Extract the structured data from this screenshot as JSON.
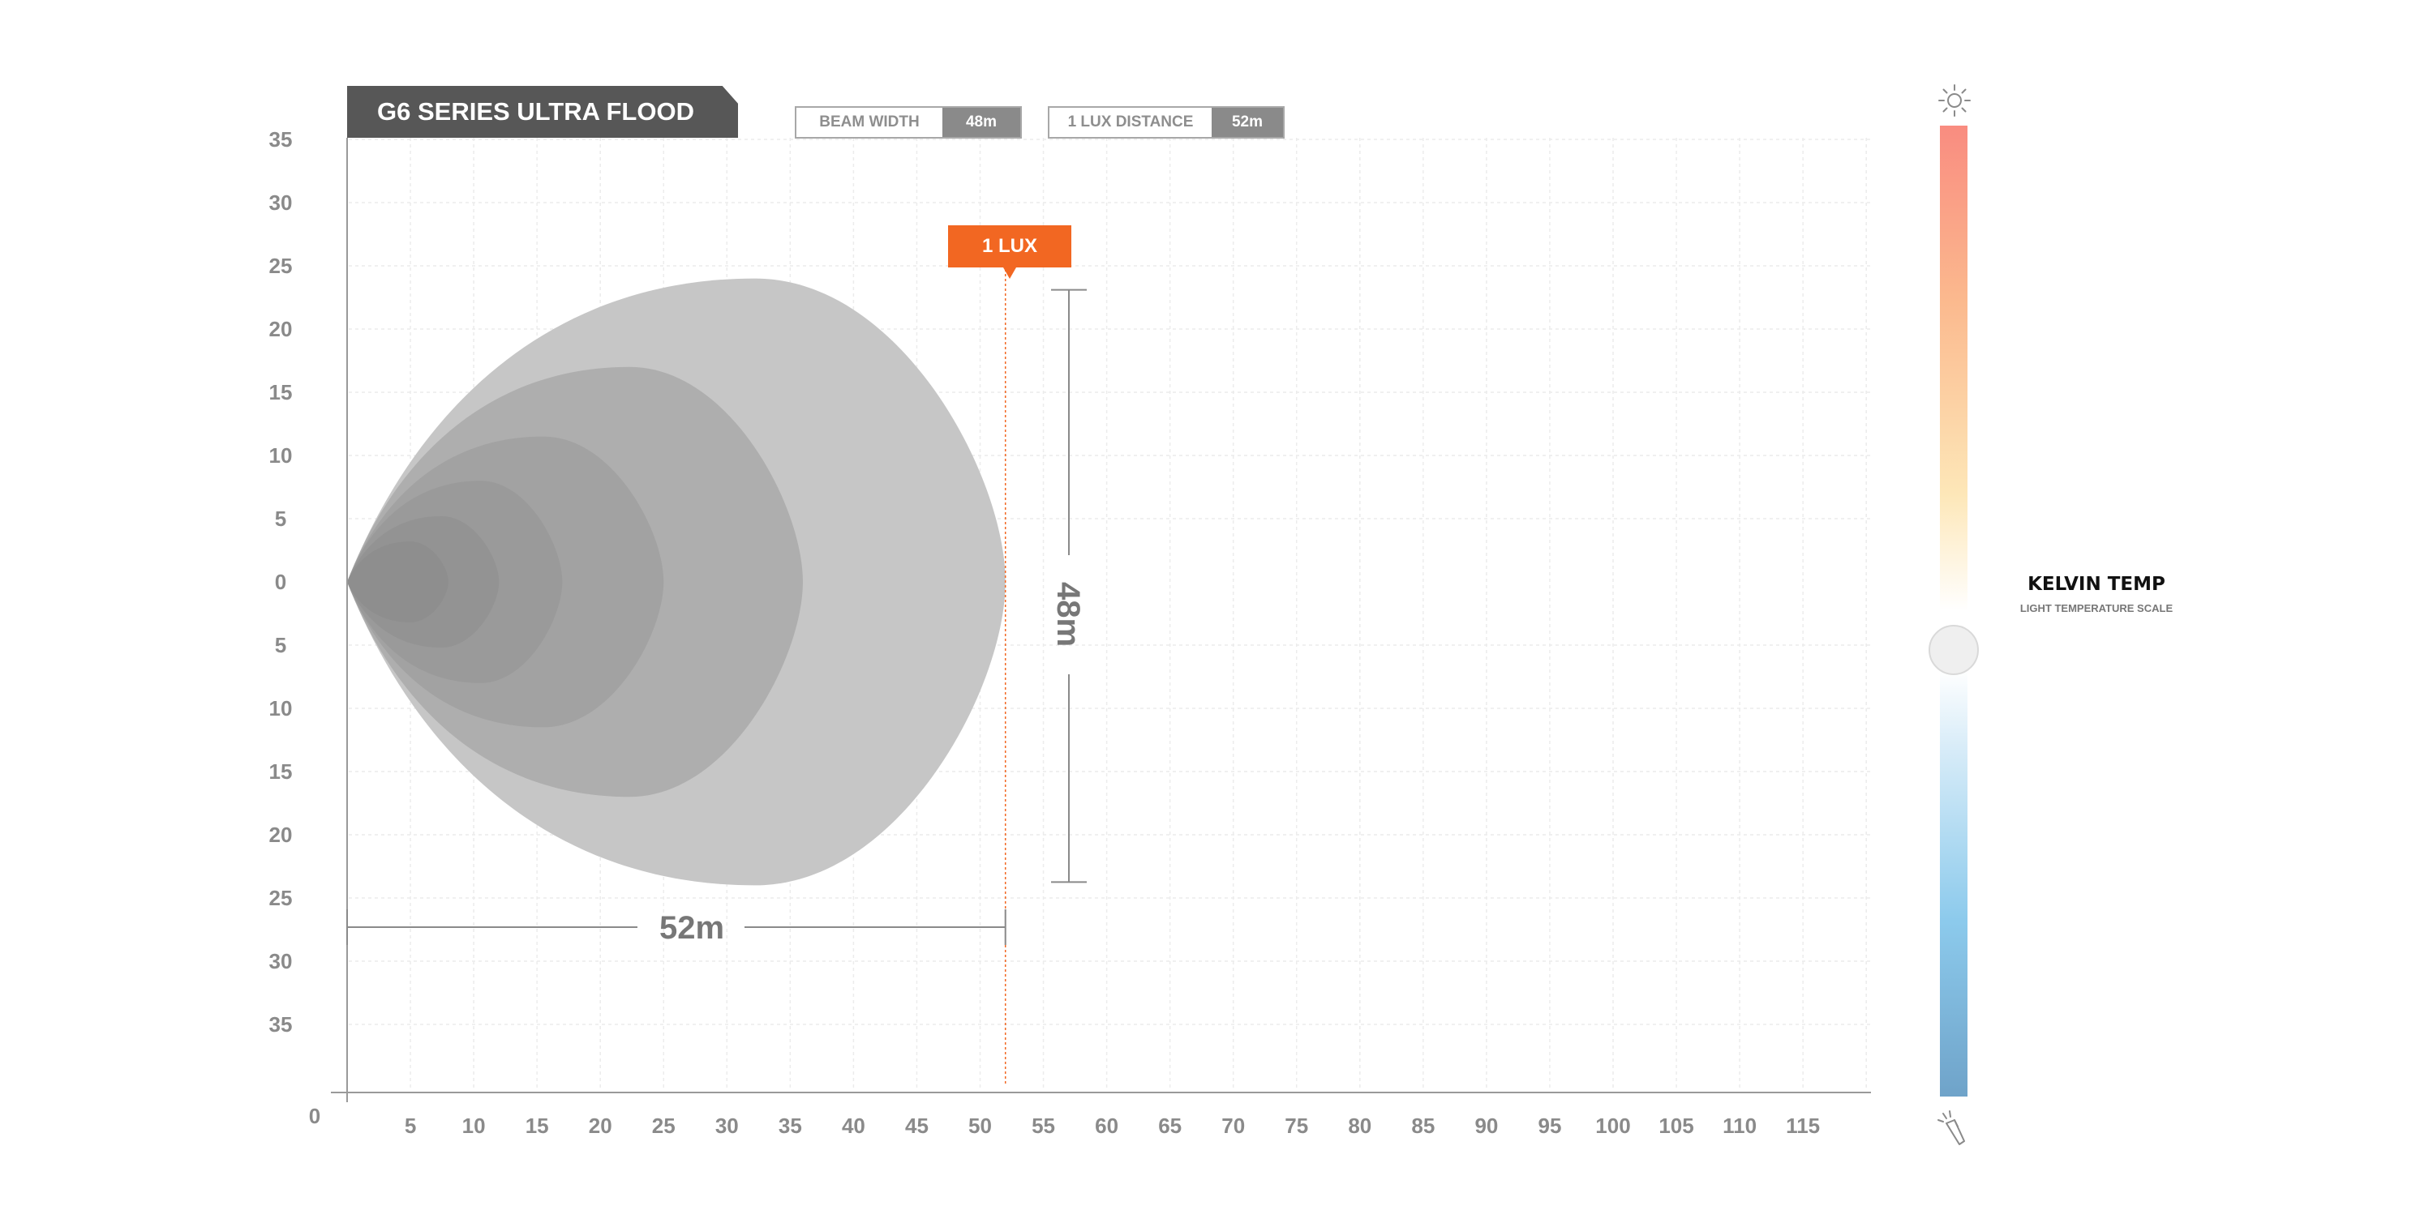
{
  "chart_data": {
    "type": "area",
    "title": "G6 SERIES ULTRA FLOOD",
    "x_ticks": [
      "5",
      "10",
      "15",
      "20",
      "25",
      "30",
      "35",
      "40",
      "45",
      "50",
      "55",
      "60",
      "65",
      "70",
      "75",
      "80",
      "85",
      "90",
      "95",
      "100",
      "105",
      "110",
      "115"
    ],
    "y_ticks_upper": [
      "35",
      "30",
      "25",
      "20",
      "15",
      "10",
      "5",
      "0"
    ],
    "y_ticks_lower": [
      "5",
      "10",
      "15",
      "20",
      "25",
      "30",
      "35"
    ],
    "origin_label": "0",
    "xlim": [
      0,
      120
    ],
    "ylim": [
      -40,
      35
    ],
    "grid": true,
    "beam_contours": [
      {
        "reach": 52,
        "half_width": 24,
        "shade": "#c6c6c6"
      },
      {
        "reach": 36,
        "half_width": 17,
        "shade": "#aeaeae"
      },
      {
        "reach": 25,
        "half_width": 11.5,
        "shade": "#a2a2a2"
      },
      {
        "reach": 17,
        "half_width": 8,
        "shade": "#9a9a9a"
      },
      {
        "reach": 12,
        "half_width": 5.2,
        "shade": "#939393"
      },
      {
        "reach": 8,
        "half_width": 3.2,
        "shade": "#8e8e8e"
      }
    ],
    "one_lux": {
      "label": "1 LUX",
      "distance": 52
    },
    "beam_width_dimension": {
      "label": "48m",
      "value": 48
    },
    "distance_dimension": {
      "label": "52m",
      "value": 52
    }
  },
  "stats": {
    "beam_width_label": "BEAM WIDTH",
    "beam_width_value": "48m",
    "lux_distance_label": "1 LUX DISTANCE",
    "lux_distance_value": "52m"
  },
  "kelvin": {
    "title": "KELVIN TEMP",
    "subtitle": "LIGHT TEMPERATURE SCALE",
    "top_icon": "sun-icon",
    "bottom_icon": "flashlight-icon",
    "knob_position": 0.54
  },
  "colors": {
    "accent": "#f26722",
    "banner": "#575757",
    "axis_text": "#8a8a8a"
  }
}
